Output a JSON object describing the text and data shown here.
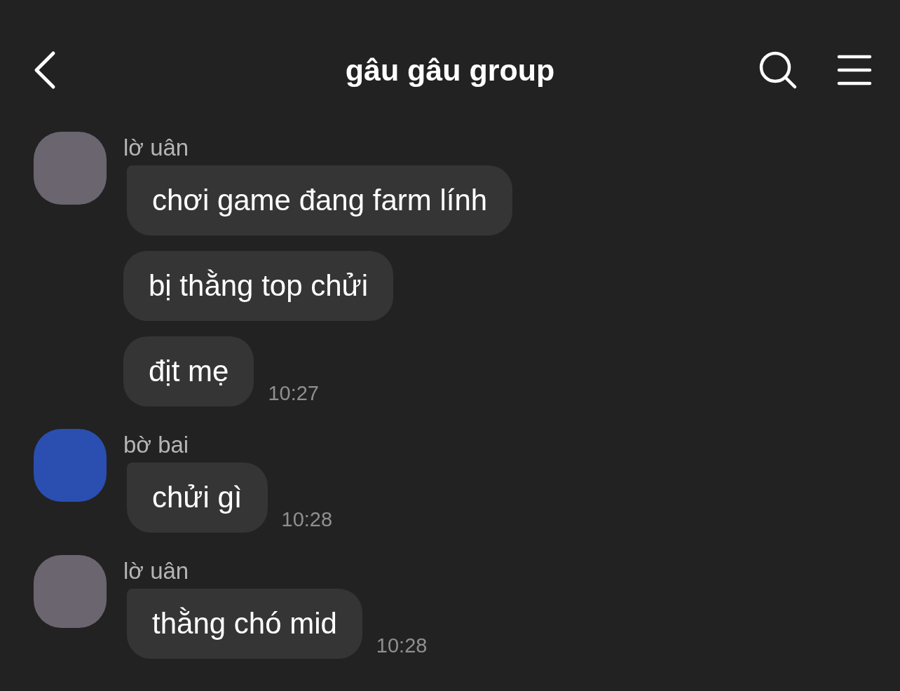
{
  "header": {
    "title": "gâu gâu group"
  },
  "groups": [
    {
      "sender": "lờ uân",
      "messages": [
        {
          "text": "chơi game đang farm lính"
        },
        {
          "text": "bị thằng top chửi"
        },
        {
          "text": "địt mẹ",
          "time": "10:27"
        }
      ]
    },
    {
      "sender": "bờ bai",
      "messages": [
        {
          "text": "chửi gì",
          "time": "10:28"
        }
      ]
    },
    {
      "sender": "lờ uân",
      "messages": [
        {
          "text": "thằng chó mid",
          "time": "10:28"
        }
      ]
    }
  ]
}
